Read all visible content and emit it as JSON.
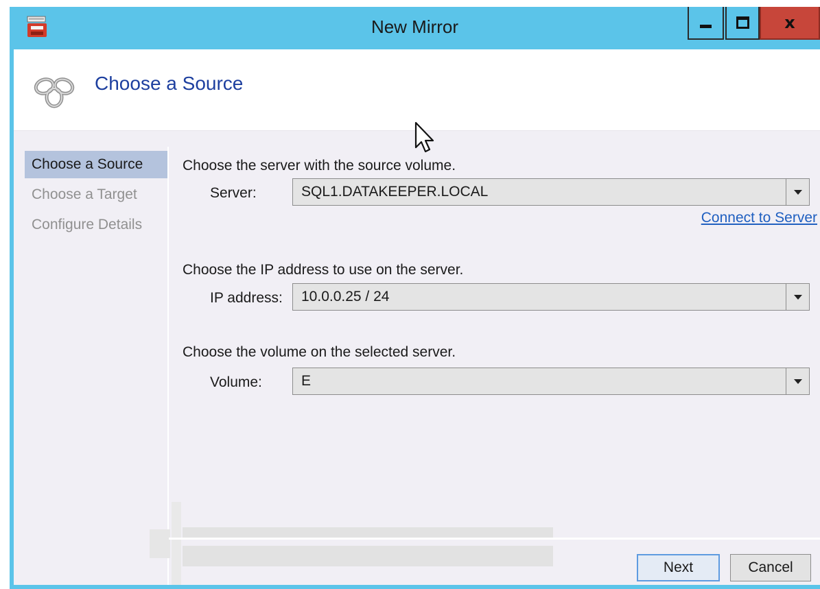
{
  "window": {
    "title": "New Mirror",
    "close_glyph": "x"
  },
  "header": {
    "title": "Choose a Source"
  },
  "nav": {
    "items": [
      {
        "label": "Choose a Source",
        "active": true
      },
      {
        "label": "Choose a Target",
        "active": false
      },
      {
        "label": "Configure Details",
        "active": false
      }
    ]
  },
  "form": {
    "server_prompt": "Choose the server with the source volume.",
    "server_label": "Server:",
    "server_value": "SQL1.DATAKEEPER.LOCAL",
    "connect_link": "Connect to Server",
    "ip_prompt": "Choose the IP address to use on the server.",
    "ip_label": "IP address:",
    "ip_value": "10.0.0.25 / 24",
    "volume_prompt": "Choose the volume on the selected server.",
    "volume_label": "Volume:",
    "volume_value": "E"
  },
  "buttons": {
    "next": "Next",
    "cancel": "Cancel"
  },
  "icons": {
    "app": "datakeeper-app-icon",
    "header": "mirror-knot-icon",
    "cursor": "mouse-pointer-icon"
  },
  "colors": {
    "titlebar": "#5bc4e9",
    "close_button": "#c7463a",
    "header_title": "#1d3f9f",
    "nav_active": "#b4c3dd",
    "link": "#1f5fc0"
  }
}
